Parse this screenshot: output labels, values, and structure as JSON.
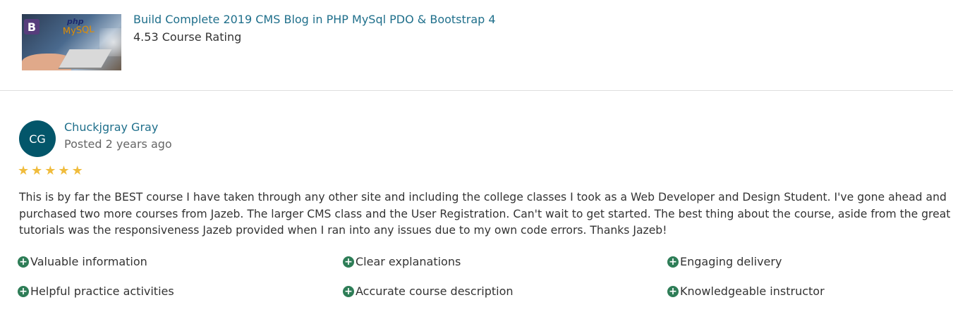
{
  "course": {
    "title": "Build Complete 2019 CMS Blog in PHP MySql PDO & Bootstrap 4",
    "rating": "4.53 Course Rating",
    "thumbnail": {
      "bootstrap_letter": "B",
      "php_text": "php",
      "mysql_text": "MySQL"
    }
  },
  "review": {
    "avatar_initials": "CG",
    "reviewer_name": "Chuckjgray Gray",
    "posted": "Posted 2 years ago",
    "star_rating": 5,
    "star_glyph": "★",
    "text": "This is by far the BEST course I have taken through any other site and including the college classes I took as a Web Developer and Design Student. I've gone ahead and purchased two more courses from Jazeb. The larger CMS class and the User Registration. Can't wait to get started. The best thing about the course, aside from the great tutorials was the responsiveness Jazeb provided when I ran into any issues due to my own code errors. Thanks Jazeb!",
    "tags": [
      {
        "label": "Valuable information"
      },
      {
        "label": "Clear explanations"
      },
      {
        "label": "Engaging delivery"
      },
      {
        "label": "Helpful practice activities"
      },
      {
        "label": "Accurate course description"
      },
      {
        "label": "Knowledgeable instructor"
      }
    ],
    "tag_icon": "plus-circle-icon"
  },
  "colors": {
    "link": "#1f6f8b",
    "avatar_bg": "#03566a",
    "star": "#f0bc3d",
    "tag_icon": "#2e7d57"
  }
}
